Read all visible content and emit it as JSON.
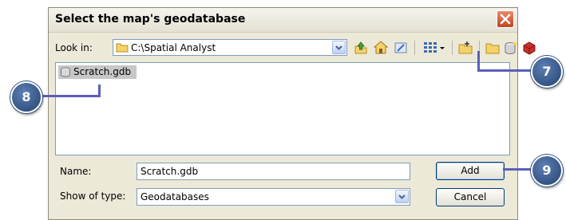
{
  "dialog": {
    "title": "Select the map's geodatabase",
    "look_in_label": "Look in:",
    "look_in_value": "C:\\Spatial Analyst",
    "toolbar_icons": [
      "up-one-level-icon",
      "home-icon",
      "folder-connect-icon",
      "view-menu-icon",
      "connect-folder-icon",
      "new-folder-icon",
      "new-geodatabase-icon",
      "toolbox-icon"
    ],
    "files": [
      {
        "name": "Scratch.gdb",
        "icon": "geodatabase-icon",
        "selected": true
      }
    ],
    "name_label": "Name:",
    "name_value": "Scratch.gdb",
    "type_label": "Show of type:",
    "type_value": "Geodatabases",
    "add_label": "Add",
    "cancel_label": "Cancel"
  },
  "callouts": {
    "new_geodatabase": "7",
    "selected_item": "8",
    "add_button": "9"
  },
  "colors": {
    "dialog_bg": "#ece9d8",
    "callout": "#2f5088",
    "leader": "#5a5fb8",
    "close": "#c2431f"
  }
}
